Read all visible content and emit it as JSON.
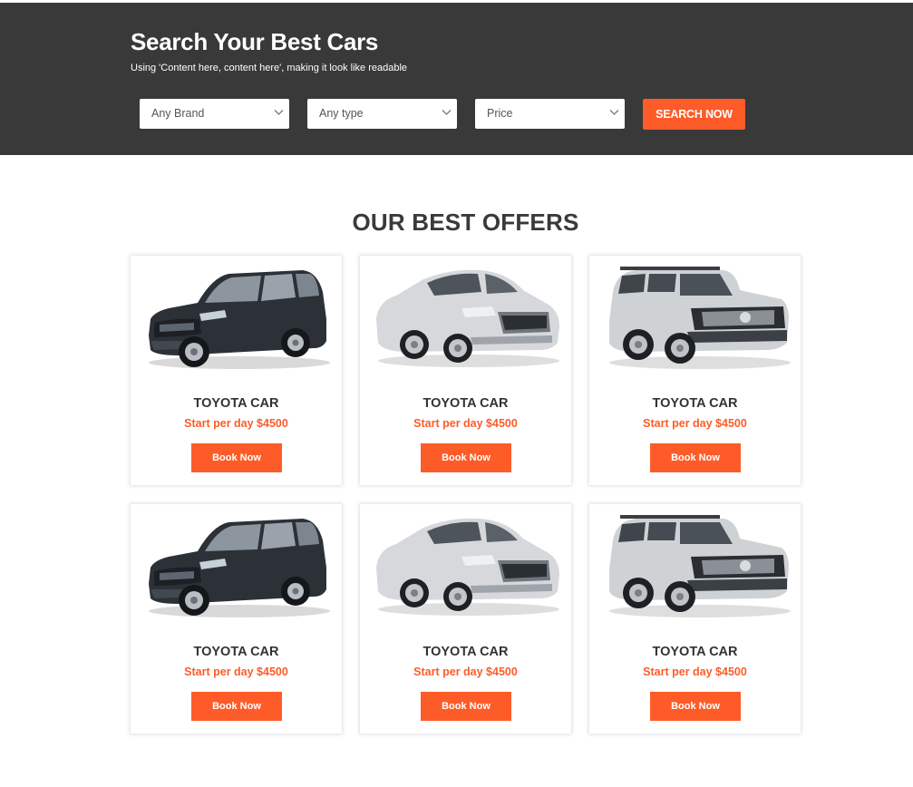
{
  "search": {
    "title": "Search Your Best Cars",
    "subtitle": "Using 'Content here, content here', making it look like readable",
    "brand_select": "Any Brand",
    "type_select": "Any type",
    "price_select": "Price",
    "button_label": "SEARCH NOW"
  },
  "offers": {
    "title": "OUR BEST OFFERS",
    "cards": [
      {
        "name": "TOYOTA CAR",
        "price": "Start per day $4500",
        "button": "Book Now",
        "car": "dark-suv"
      },
      {
        "name": "TOYOTA CAR",
        "price": "Start per day $4500",
        "button": "Book Now",
        "car": "silver-sedan"
      },
      {
        "name": "TOYOTA CAR",
        "price": "Start per day $4500",
        "button": "Book Now",
        "car": "silver-suv"
      },
      {
        "name": "TOYOTA CAR",
        "price": "Start per day $4500",
        "button": "Book Now",
        "car": "dark-suv"
      },
      {
        "name": "TOYOTA CAR",
        "price": "Start per day $4500",
        "button": "Book Now",
        "car": "silver-sedan"
      },
      {
        "name": "TOYOTA CAR",
        "price": "Start per day $4500",
        "button": "Book Now",
        "car": "silver-suv"
      }
    ]
  },
  "colors": {
    "accent": "#fd5c28",
    "band": "#393939"
  }
}
